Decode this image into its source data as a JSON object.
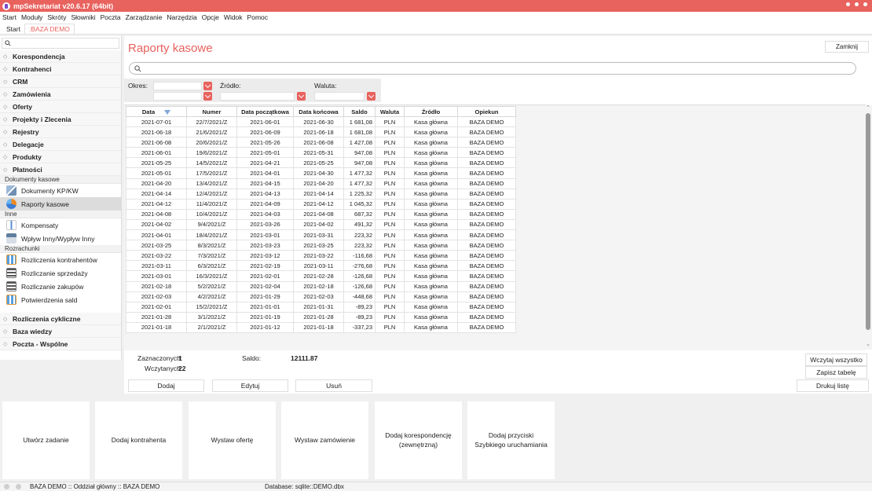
{
  "window": {
    "title": "mpSekretariat v20.6.17 (64bit)"
  },
  "menu": [
    "Start",
    "Moduły",
    "Skróty",
    "Słowniki",
    "Poczta",
    "Zarządzanie",
    "Narzędzia",
    "Opcje",
    "Widok",
    "Pomoc"
  ],
  "tabs": [
    {
      "label": "Start"
    },
    {
      "label": ":BAZA DEMO"
    }
  ],
  "sidebar": {
    "sections_top": [
      "Korespondencja",
      "Kontrahenci",
      "CRM",
      "Zamówienia",
      "Oferty",
      "Projekty i Zlecenia",
      "Rejestry",
      "Delegacje",
      "Produkty",
      "Płatności"
    ],
    "group_dokumenty": "Dokumenty kasowe",
    "items_dokumenty": [
      "Dokumenty KP/KW",
      "Raporty kasowe"
    ],
    "group_inne": "Inne",
    "items_inne": [
      "Kompensaty",
      "Wpływ Inny/Wypływ Inny"
    ],
    "group_rozrachunki": "Rozrachunki",
    "items_rozrachunki": [
      "Rozliczenia kontrahentów",
      "Rozliczanie sprzedaży",
      "Rozliczanie zakupów",
      "Potwierdzenia sald"
    ],
    "sections_bottom": [
      "Rozliczenia cykliczne",
      "Baza wiedzy",
      "Poczta - Wspólne"
    ]
  },
  "page": {
    "title": "Raporty kasowe",
    "close_label": "Zamknij"
  },
  "filters": {
    "okres": "Okres:",
    "zrodlo": "Źródło:",
    "waluta": "Waluta:"
  },
  "table": {
    "columns": [
      "Data",
      "Numer",
      "Data początkowa",
      "Data końcowa",
      "Saldo",
      "Waluta",
      "Źródło",
      "Opiekun"
    ],
    "rows": [
      [
        "2021-07-01",
        "22/7/2021/Z",
        "2021-06-01",
        "2021-06-30",
        "1 681,08",
        "PLN",
        "Kasa główna",
        "BAZA DEMO"
      ],
      [
        "2021-06-18",
        "21/6/2021/Z",
        "2021-06-09",
        "2021-06-18",
        "1 681,08",
        "PLN",
        "Kasa główna",
        "BAZA DEMO"
      ],
      [
        "2021-06-08",
        "20/6/2021/Z",
        "2021-05-26",
        "2021-06-08",
        "1 427,08",
        "PLN",
        "Kasa główna",
        "BAZA DEMO"
      ],
      [
        "2021-06-01",
        "19/6/2021/Z",
        "2021-05-01",
        "2021-05-31",
        "947,08",
        "PLN",
        "Kasa główna",
        "BAZA DEMO"
      ],
      [
        "2021-05-25",
        "14/5/2021/Z",
        "2021-04-21",
        "2021-05-25",
        "947,08",
        "PLN",
        "Kasa główna",
        "BAZA DEMO"
      ],
      [
        "2021-05-01",
        "17/5/2021/Z",
        "2021-04-01",
        "2021-04-30",
        "1 477,32",
        "PLN",
        "Kasa główna",
        "BAZA DEMO"
      ],
      [
        "2021-04-20",
        "13/4/2021/Z",
        "2021-04-15",
        "2021-04-20",
        "1 477,32",
        "PLN",
        "Kasa główna",
        "BAZA DEMO"
      ],
      [
        "2021-04-14",
        "12/4/2021/Z",
        "2021-04-13",
        "2021-04-14",
        "1 225,32",
        "PLN",
        "Kasa główna",
        "BAZA DEMO"
      ],
      [
        "2021-04-12",
        "11/4/2021/Z",
        "2021-04-09",
        "2021-04-12",
        "1 045,32",
        "PLN",
        "Kasa główna",
        "BAZA DEMO"
      ],
      [
        "2021-04-08",
        "10/4/2021/Z",
        "2021-04-03",
        "2021-04-08",
        "687,32",
        "PLN",
        "Kasa główna",
        "BAZA DEMO"
      ],
      [
        "2021-04-02",
        "9/4/2021/Z",
        "2021-03-26",
        "2021-04-02",
        "491,32",
        "PLN",
        "Kasa główna",
        "BAZA DEMO"
      ],
      [
        "2021-04-01",
        "18/4/2021/Z",
        "2021-03-01",
        "2021-03-31",
        "223,32",
        "PLN",
        "Kasa główna",
        "BAZA DEMO"
      ],
      [
        "2021-03-25",
        "8/3/2021/Z",
        "2021-03-23",
        "2021-03-25",
        "223,32",
        "PLN",
        "Kasa główna",
        "BAZA DEMO"
      ],
      [
        "2021-03-22",
        "7/3/2021/Z",
        "2021-03-12",
        "2021-03-22",
        "-116,68",
        "PLN",
        "Kasa główna",
        "BAZA DEMO"
      ],
      [
        "2021-03-11",
        "6/3/2021/Z",
        "2021-02-19",
        "2021-03-11",
        "-276,68",
        "PLN",
        "Kasa główna",
        "BAZA DEMO"
      ],
      [
        "2021-03-01",
        "16/3/2021/Z",
        "2021-02-01",
        "2021-02-28",
        "-126,68",
        "PLN",
        "Kasa główna",
        "BAZA DEMO"
      ],
      [
        "2021-02-18",
        "5/2/2021/Z",
        "2021-02-04",
        "2021-02-18",
        "-126,68",
        "PLN",
        "Kasa główna",
        "BAZA DEMO"
      ],
      [
        "2021-02-03",
        "4/2/2021/Z",
        "2021-01-29",
        "2021-02-03",
        "-448,68",
        "PLN",
        "Kasa główna",
        "BAZA DEMO"
      ],
      [
        "2021-02-01",
        "15/2/2021/Z",
        "2021-01-01",
        "2021-01-31",
        "-89,23",
        "PLN",
        "Kasa główna",
        "BAZA DEMO"
      ],
      [
        "2021-01-28",
        "3/1/2021/Z",
        "2021-01-19",
        "2021-01-28",
        "-89,23",
        "PLN",
        "Kasa główna",
        "BAZA DEMO"
      ],
      [
        "2021-01-18",
        "2/1/2021/Z",
        "2021-01-12",
        "2021-01-18",
        "-337,23",
        "PLN",
        "Kasa główna",
        "BAZA DEMO"
      ]
    ]
  },
  "summary": {
    "zaznaczonych_label": "Zaznaczonych:",
    "zaznaczonych_value": "1",
    "saldo_label": "Saldo:",
    "saldo_value": "12111.87",
    "wczytanych_label": "Wczytanych:",
    "wczytanych_value": "22"
  },
  "buttons": {
    "wczytaj": "Wczytaj wszystko",
    "zapisz": "Zapisz tabelę",
    "dodaj": "Dodaj",
    "edytuj": "Edytuj",
    "usun": "Usuń",
    "drukuj": "Drukuj listę"
  },
  "tiles": [
    "Utwórz zadanie",
    "Dodaj kontrahenta",
    "Wystaw ofertę",
    "Wystaw zamówienie",
    "Dodaj korespondencję (zewnętrzną)",
    "Dodaj przyciski Szybkiego uruchamiania"
  ],
  "status": {
    "left": "BAZA DEMO :: Oddział główny :: BAZA DEMO",
    "database": "Database: sqlite::DEMO.dbx"
  },
  "colors": {
    "accent": "#e8625e",
    "selected": "#dcdcdc"
  }
}
